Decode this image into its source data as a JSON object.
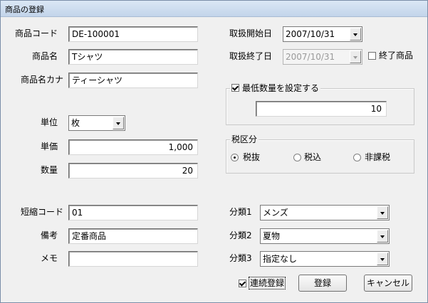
{
  "window": {
    "title": "商品の登録"
  },
  "left": {
    "product_code": {
      "label": "商品コード",
      "value": "DE-100001"
    },
    "product_name": {
      "label": "商品名",
      "value": "Tシャツ"
    },
    "product_kana": {
      "label": "商品名カナ",
      "value": "ティーシャツ"
    },
    "unit": {
      "label": "単位",
      "value": "枚"
    },
    "unit_price": {
      "label": "単価",
      "value": "1,000"
    },
    "quantity": {
      "label": "数量",
      "value": "20"
    },
    "short_code": {
      "label": "短縮コード",
      "value": "01"
    },
    "remarks": {
      "label": "備考",
      "value": "定番商品"
    },
    "memo": {
      "label": "メモ",
      "value": ""
    }
  },
  "right": {
    "start_date": {
      "label": "取扱開始日",
      "value": "2007/10/31"
    },
    "end_date": {
      "label": "取扱終了日",
      "value": "2007/10/31",
      "disabled": true
    },
    "end_product": {
      "label": "終了商品",
      "checked": false
    },
    "min_qty": {
      "label": "最低数量を設定する",
      "checked": true,
      "value": "10"
    },
    "tax": {
      "caption": "税区分",
      "options": [
        {
          "label": "税抜",
          "selected": true
        },
        {
          "label": "税込",
          "selected": false
        },
        {
          "label": "非課税",
          "selected": false
        }
      ]
    },
    "category1": {
      "label": "分類1",
      "value": "メンズ"
    },
    "category2": {
      "label": "分類2",
      "value": "夏物"
    },
    "category3": {
      "label": "分類3",
      "value": "指定なし"
    }
  },
  "footer": {
    "continuous": {
      "label": "連続登録",
      "checked": true
    },
    "register_label": "登録",
    "cancel_label": "キャンセル"
  }
}
